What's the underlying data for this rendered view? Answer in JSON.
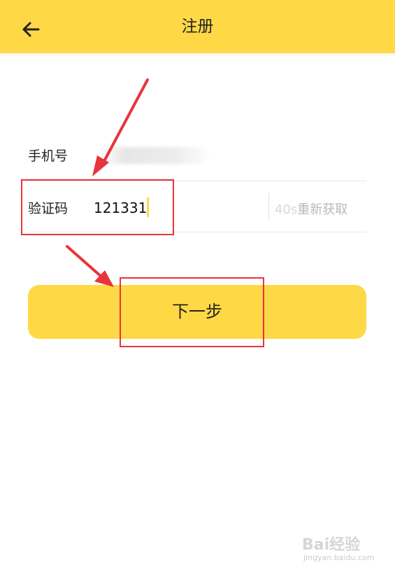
{
  "header": {
    "title": "注册",
    "background": "#ffd945"
  },
  "form": {
    "phone_label": "手机号",
    "code_label": "验证码",
    "code_value": "121331",
    "resend_countdown": "40s",
    "resend_label": "重新获取"
  },
  "actions": {
    "next_label": "下一步"
  },
  "annotation": {
    "color": "#e8343a"
  },
  "watermark": {
    "logo_text": "Bai经验",
    "sub_text": "jingyan.baidu.com"
  }
}
